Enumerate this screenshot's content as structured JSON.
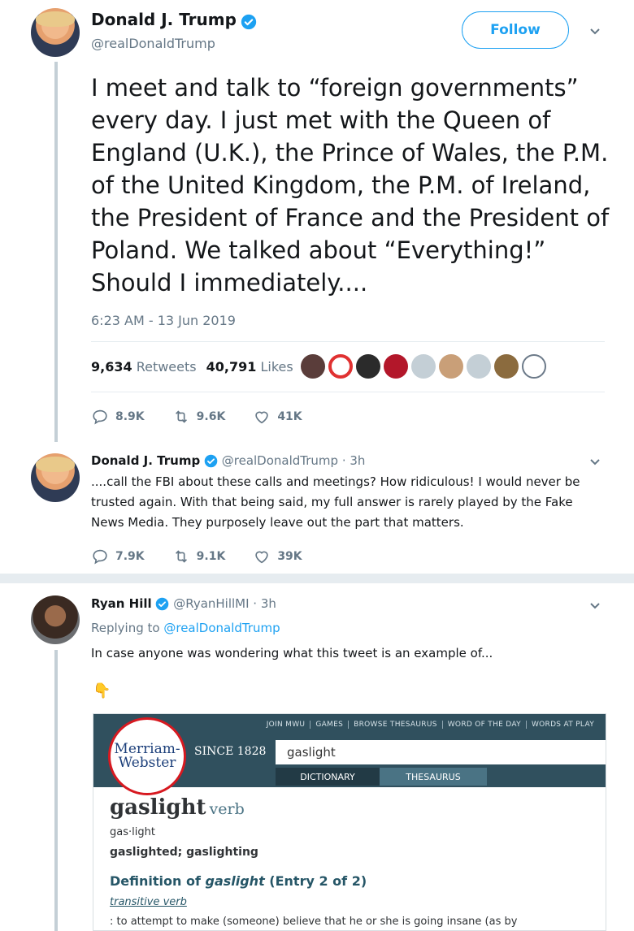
{
  "main_tweet": {
    "author_name": "Donald J. Trump",
    "handle": "@realDonaldTrump",
    "follow_label": "Follow",
    "text": "I meet and talk to “foreign governments” every day. I just met with the Queen of England (U.K.), the Prince of Wales, the P.M. of the United Kingdom, the P.M. of Ireland, the President of France and the President of Poland. We talked about “Everything!” Should I immediately....",
    "timestamp": "6:23 AM - 13 Jun 2019",
    "retweets_count": "9,634",
    "retweets_label": "Retweets",
    "likes_count": "40,791",
    "likes_label": "Likes",
    "actions": {
      "replies": "8.9K",
      "retweets": "9.6K",
      "likes": "41K"
    }
  },
  "thread_reply": {
    "author_name": "Donald J. Trump",
    "handle_time": "@realDonaldTrump · 3h",
    "text": "....call the FBI about these calls and meetings? How ridiculous! I would never be trusted again. With that being said, my full answer is rarely played by the Fake News Media. They purposely leave out the part that matters.",
    "actions": {
      "replies": "7.9K",
      "retweets": "9.1K",
      "likes": "39K"
    }
  },
  "reply": {
    "author_name": "Ryan Hill",
    "handle_time": "@RyanHillMI · 3h",
    "replying_prefix": "Replying to",
    "replying_to": "@realDonaldTrump",
    "text": "In case anyone was wondering what this tweet is an example of...",
    "emoji": "👇"
  },
  "mw_image": {
    "nav_links": [
      "JOIN MWU",
      "GAMES",
      "BROWSE THESAURUS",
      "WORD OF THE DAY",
      "WORDS AT PLAY"
    ],
    "logo_line1": "Merriam-",
    "logo_line2": "Webster",
    "since": "SINCE 1828",
    "search_value": "gaslight",
    "tab_dictionary": "DICTIONARY",
    "tab_thesaurus": "THESAURUS",
    "word": "gaslight",
    "pos": "verb",
    "syllables": "gas·light",
    "forms": "gaslighted; gaslighting",
    "def_prefix": "Definition of ",
    "def_word": "gaslight",
    "def_suffix": " (Entry 2 of 2)",
    "transitive": "transitive verb",
    "sense": ": to attempt to make (someone) believe that he or she is going insane (as by"
  },
  "colors": {
    "twitter_blue": "#1da1f2",
    "secondary_text": "#657786",
    "mw_header": "#30505e",
    "mw_red": "#d71920"
  }
}
